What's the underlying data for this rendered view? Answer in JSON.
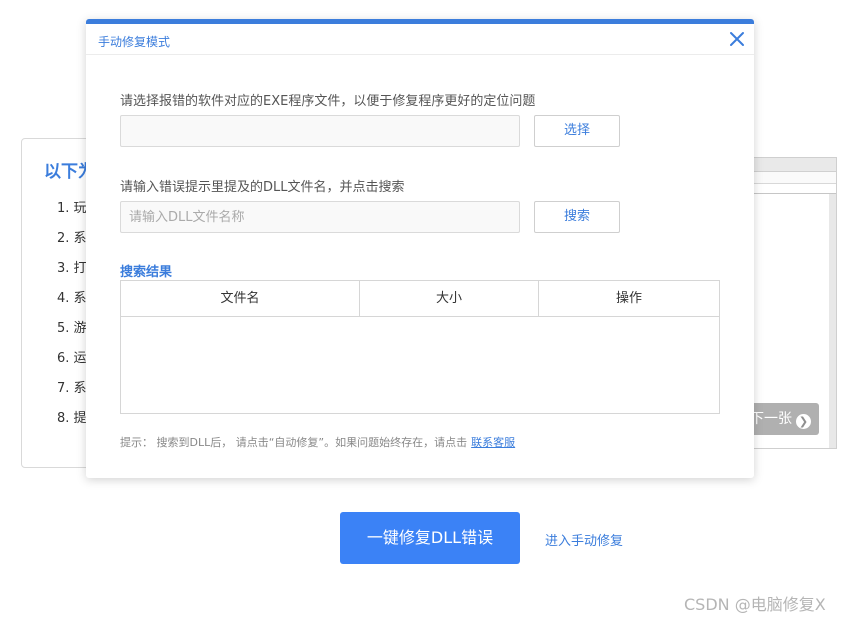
{
  "background": {
    "card_title": "以下为",
    "list": [
      "1. 玩",
      "2. 系",
      "3. 打",
      "4. 系",
      "5. 游",
      "6. 运",
      "7. 系",
      "8. 提"
    ],
    "next_label": "下一张"
  },
  "dialog": {
    "title": "手动修复模式",
    "exe_label": "请选择报错的软件对应的EXE程序文件，以便于修复程序更好的定位问题",
    "exe_value": "",
    "select_button": "选择",
    "dll_label": "请输入错误提示里提及的DLL文件名，并点击搜索",
    "dll_placeholder": "请输入DLL文件名称",
    "search_button": "搜索",
    "results_title": "搜索结果",
    "table": {
      "columns": [
        "文件名",
        "大小",
        "操作"
      ],
      "rows": []
    },
    "tip_text": "提示： 搜索到DLL后， 请点击“自动修复”。如果问题始终存在，请点击",
    "tip_link": "联系客服"
  },
  "actions": {
    "primary_button": "一键修复DLL错误",
    "manual_link": "进入手动修复"
  },
  "watermark": "CSDN @电脑修复X",
  "colors": {
    "accent": "#3b7ddc",
    "primary_button": "#3b82f6"
  }
}
